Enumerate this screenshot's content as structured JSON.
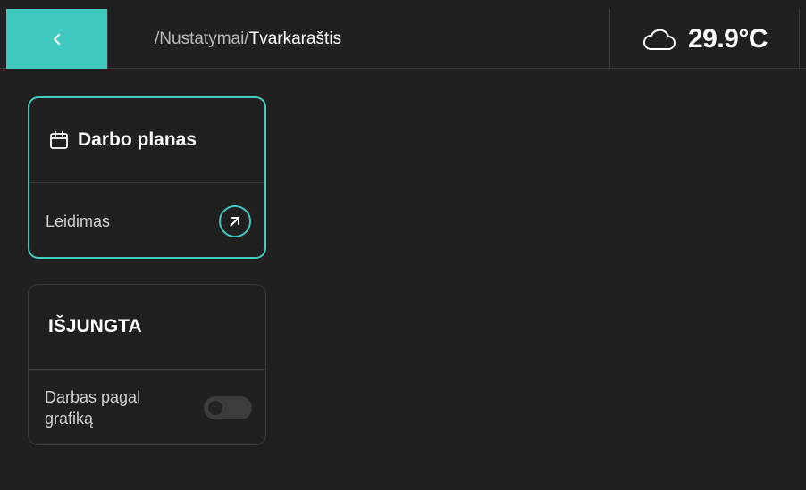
{
  "header": {
    "breadcrumb_parent": "/Nustatymai/",
    "breadcrumb_current": "Tvarkaraštis"
  },
  "weather": {
    "icon": "cloud-icon",
    "temperature": "29.9°C"
  },
  "schedule_card": {
    "icon": "calendar-icon",
    "title": "Darbo planas",
    "footer_label": "Leidimas"
  },
  "status_card": {
    "title": "IŠJUNGTA",
    "footer_label": "Darbas pagal grafiką",
    "toggle_on": false
  },
  "colors": {
    "accent": "#40c9bf",
    "background": "#202020",
    "border": "#3c3c3c"
  }
}
